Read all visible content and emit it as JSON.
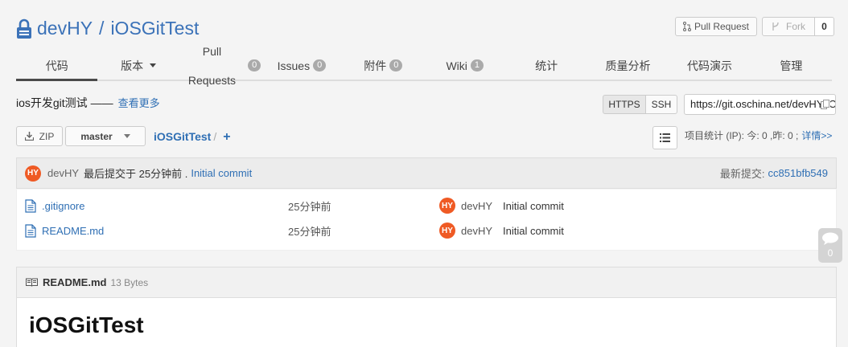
{
  "repo": {
    "owner": "devHY",
    "separator": "/",
    "name": "iOSGitTest"
  },
  "actions": {
    "pull_request": "Pull Request",
    "fork": "Fork",
    "fork_count": "0"
  },
  "nav": {
    "code": "代码",
    "versions": "版本",
    "pull_requests": "Pull Requests",
    "pull_requests_count": "0",
    "issues": "Issues",
    "issues_count": "0",
    "attachments": "附件",
    "attachments_count": "0",
    "wiki": "Wiki",
    "wiki_count": "1",
    "stats": "统计",
    "quality": "质量分析",
    "demo": "代码演示",
    "manage": "管理"
  },
  "description": {
    "text": "ios开发git测试 ——",
    "more": "查看更多"
  },
  "clone": {
    "https": "HTTPS",
    "ssh": "SSH",
    "url": "https://git.oschina.net/devHY/iOSGitTest.git"
  },
  "toolbar": {
    "zip": "ZIP",
    "branch": "master",
    "path_repo": "iOSGitTest",
    "path_slash": "/",
    "plus": "+"
  },
  "stats": {
    "text": "项目统计 (IP): 今: 0 ,昨: 0 ;",
    "details": "详情>>"
  },
  "last_commit": {
    "avatar": "HY",
    "author": "devHY",
    "text": "最后提交于 25分钟前 .",
    "message": "Initial commit",
    "latest_label": "最新提交:",
    "hash": "cc851bfb549"
  },
  "files": [
    {
      "name": ".gitignore",
      "time": "25分钟前",
      "avatar": "HY",
      "author": "devHY",
      "message": "Initial commit"
    },
    {
      "name": "README.md",
      "time": "25分钟前",
      "avatar": "HY",
      "author": "devHY",
      "message": "Initial commit"
    }
  ],
  "comments": {
    "count": "0"
  },
  "readme": {
    "name": "README.md",
    "size": "13 Bytes",
    "heading": "iOSGitTest"
  },
  "colors": {
    "accent": "#2f6fb4",
    "avatar": "#ef5a24"
  }
}
